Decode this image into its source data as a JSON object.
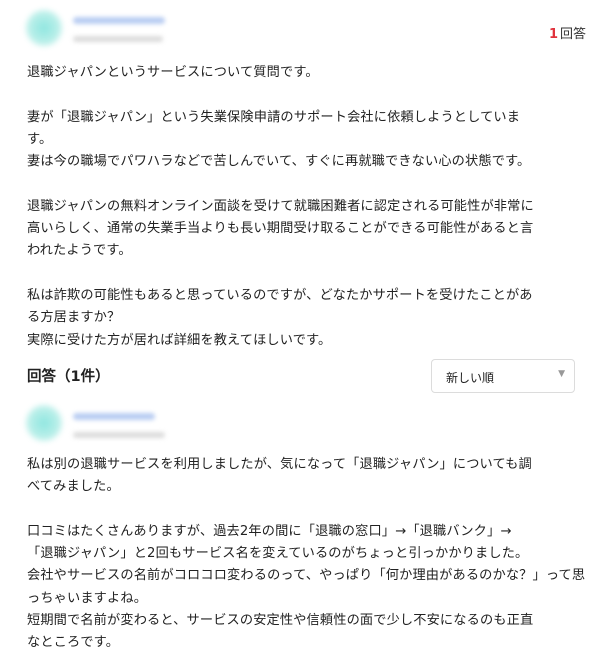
{
  "question": {
    "answer_count_number": "1",
    "answer_count_suffix": "回答",
    "body": "退職ジャパンというサービスについて質問です。\n\n妻が「退職ジャパン」という失業保険申請のサポート会社に依頼しようとしていま\nす。\n妻は今の職場でパワハラなどで苦しんでいて、すぐに再就職できない心の状態です。\n\n退職ジャパンの無料オンライン面談を受けて就職困難者に認定される可能性が非常に\n高いらしく、通常の失業手当よりも長い期間受け取ることができる可能性があると言\nわれたようです。\n\n私は詐欺の可能性もあると思っているのですが、どなたかサポートを受けたことがあ\nる方居ますか？\n実際に受けた方が居れば詳細を教えてほしいです。"
  },
  "answers_header": {
    "title": "回答（1件）",
    "sort_selected": "新しい順"
  },
  "answer": {
    "body": "私は別の退職サービスを利用しましたが、気になって「退職ジャパン」についても調\nべてみました。\n\n口コミはたくさんありますが、過去2年の間に「退職の窓口」→「退職バンク」→\n「退職ジャパン」と2回もサービス名を変えているのがちょっと引っかかりました。\n会社やサービスの名前がコロコロ変わるのって、やっぱり「何か理由があるのかな？」って思っちゃいますよね。\n短期間で名前が変わると、サービスの安定性や信頼性の面で少し不安になるのも正直\nなところです。"
  },
  "colors": {
    "accent_red": "#e0323c",
    "avatar_teal": "#8ee6e0",
    "blurred_name": "#b9cdf2"
  },
  "icons": {
    "sort": "chevron-down-icon"
  }
}
